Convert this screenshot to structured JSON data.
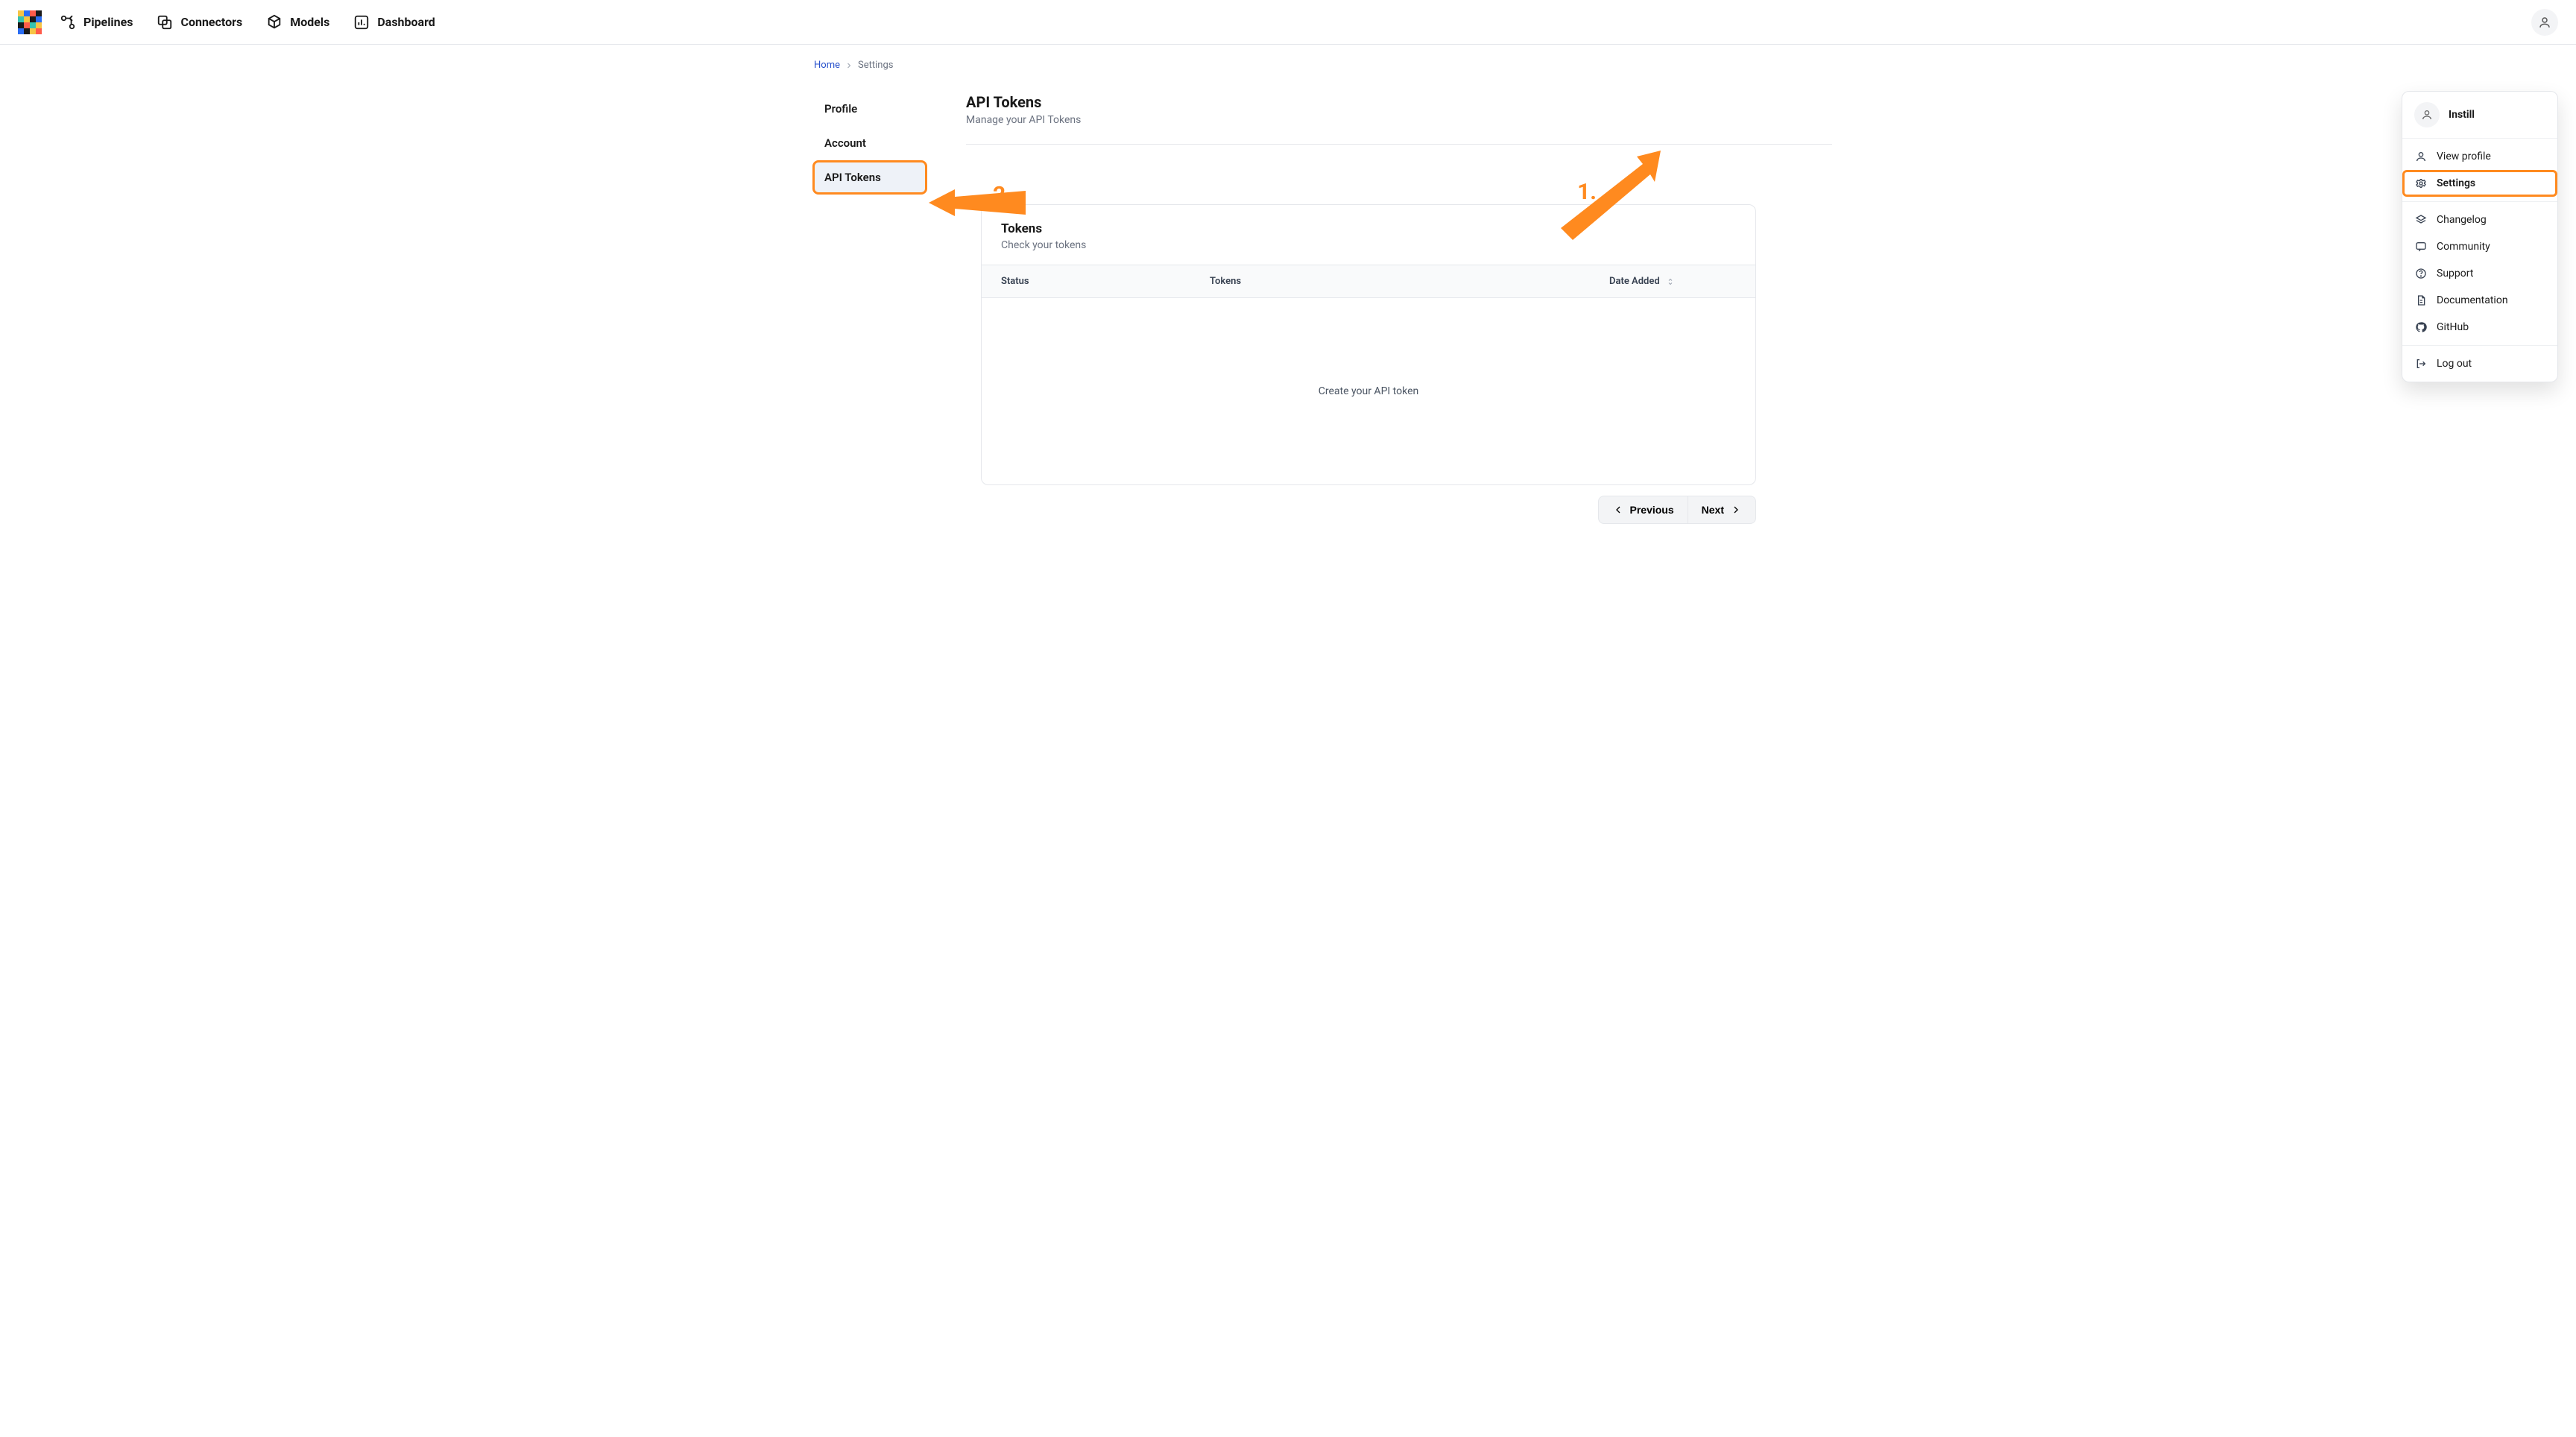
{
  "nav": {
    "items": [
      {
        "label": "Pipelines"
      },
      {
        "label": "Connectors"
      },
      {
        "label": "Models"
      },
      {
        "label": "Dashboard"
      }
    ]
  },
  "breadcrumb": {
    "home": "Home",
    "current": "Settings"
  },
  "sidebar": {
    "items": [
      {
        "label": "Profile"
      },
      {
        "label": "Account"
      },
      {
        "label": "API Tokens"
      }
    ]
  },
  "page": {
    "title": "API Tokens",
    "subtitle": "Manage your API Tokens"
  },
  "tokens_card": {
    "title": "Tokens",
    "subtitle": "Check your tokens",
    "cols": {
      "status": "Status",
      "tokens": "Tokens",
      "date": "Date Added"
    },
    "empty": "Create your API token"
  },
  "pager": {
    "prev": "Previous",
    "next": "Next"
  },
  "user_menu": {
    "name": "Instill",
    "items_a": [
      {
        "label": "View profile"
      },
      {
        "label": "Settings",
        "highlight": true
      }
    ],
    "items_b": [
      {
        "label": "Changelog"
      },
      {
        "label": "Community"
      },
      {
        "label": "Support"
      },
      {
        "label": "Documentation"
      },
      {
        "label": "GitHub"
      }
    ],
    "items_c": [
      {
        "label": "Log out"
      }
    ]
  },
  "annotations": {
    "one": "1.",
    "two": "2."
  }
}
